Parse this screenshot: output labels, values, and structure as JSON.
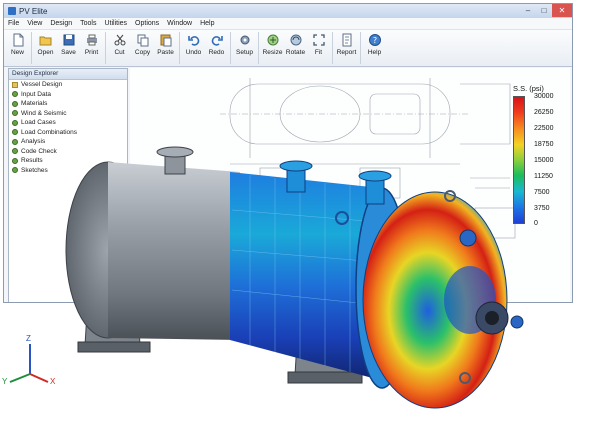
{
  "window": {
    "title": "PV Elite"
  },
  "menu": [
    "File",
    "View",
    "Design",
    "Tools",
    "Utilities",
    "Options",
    "Window",
    "Help"
  ],
  "toolbar": [
    {
      "label": "New",
      "icon": "new-file-icon"
    },
    {
      "label": "Open",
      "icon": "open-folder-icon"
    },
    {
      "label": "Save",
      "icon": "save-icon"
    },
    {
      "label": "Print",
      "icon": "print-icon"
    },
    {
      "label": "Cut",
      "icon": "cut-icon"
    },
    {
      "label": "Copy",
      "icon": "copy-icon"
    },
    {
      "label": "Paste",
      "icon": "paste-icon"
    },
    {
      "label": "Undo",
      "icon": "undo-icon"
    },
    {
      "label": "Redo",
      "icon": "redo-icon"
    },
    {
      "label": "Setup",
      "icon": "setup-icon"
    },
    {
      "label": "Resize",
      "icon": "resize-icon"
    },
    {
      "label": "Rotate",
      "icon": "rotate-icon"
    },
    {
      "label": "Fit",
      "icon": "fit-icon"
    },
    {
      "label": "Report",
      "icon": "report-icon"
    },
    {
      "label": "Help",
      "icon": "help-icon"
    }
  ],
  "explorer": {
    "title": "Design Explorer",
    "items": [
      "Vessel Design",
      "Input Data",
      "Materials",
      "Wind & Seismic",
      "Load Cases",
      "Load Combinations",
      "Analysis",
      "Code Check",
      "Results",
      "Sketches"
    ]
  },
  "legend": {
    "title": "S.S. (psi)",
    "ticks": [
      "30000",
      "26250",
      "22500",
      "18750",
      "15000",
      "11250",
      "7500",
      "3750",
      "0"
    ],
    "colors": [
      "#d4141a",
      "#f03b1d",
      "#f88a1e",
      "#f2d324",
      "#8bd03c",
      "#1cbd5b",
      "#1ab8d2",
      "#1c74e6",
      "#1f3fd6"
    ]
  },
  "axes": {
    "x": "X",
    "y": "Y",
    "z": "Z"
  }
}
